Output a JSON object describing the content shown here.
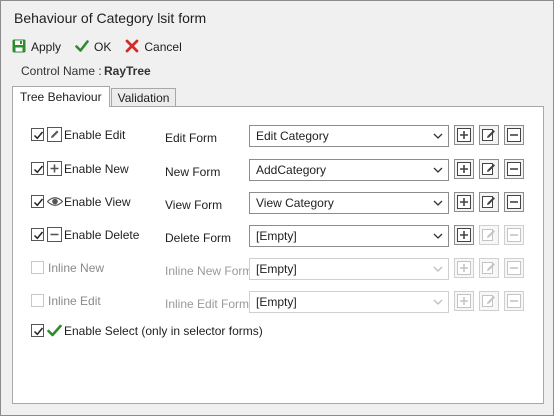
{
  "window": {
    "title": "Behaviour of Category lsit form"
  },
  "toolbar": {
    "apply_label": "Apply",
    "ok_label": "OK",
    "cancel_label": "Cancel"
  },
  "control": {
    "label": "Control Name :",
    "value": "RayTree"
  },
  "tabs": [
    {
      "label": "Tree Behaviour",
      "active": true
    },
    {
      "label": "Validation",
      "active": false
    }
  ],
  "rows": [
    {
      "label": "Enable Edit",
      "checked": true,
      "icon": "pencil-icon",
      "form_label": "Edit Form",
      "form_value": "Edit Category",
      "enabled": true
    },
    {
      "label": "Enable New",
      "checked": true,
      "icon": "plus-box-icon",
      "form_label": "New Form",
      "form_value": "AddCategory",
      "enabled": true
    },
    {
      "label": "Enable View",
      "checked": true,
      "icon": "eye-icon",
      "form_label": "View Form",
      "form_value": "View Category",
      "enabled": true
    },
    {
      "label": "Enable Delete",
      "checked": true,
      "icon": "minus-box-icon",
      "form_label": "Delete Form",
      "form_value": "[Empty]",
      "enabled": true
    },
    {
      "label": "Inline New",
      "checked": false,
      "icon": "",
      "form_label": "Inline New Form",
      "form_value": "[Empty]",
      "enabled": false
    },
    {
      "label": "Inline Edit",
      "checked": false,
      "icon": "",
      "form_label": "Inline Edit Form",
      "form_value": "[Empty]",
      "enabled": false
    }
  ],
  "enable_select": {
    "label": "Enable Select (only in selector forms)",
    "checked": true,
    "icon": "checkmark-icon"
  },
  "colors": {
    "accent_green": "#2e8b2e",
    "cancel_red": "#d42a2a",
    "disabled_text": "#9a9a9a"
  }
}
